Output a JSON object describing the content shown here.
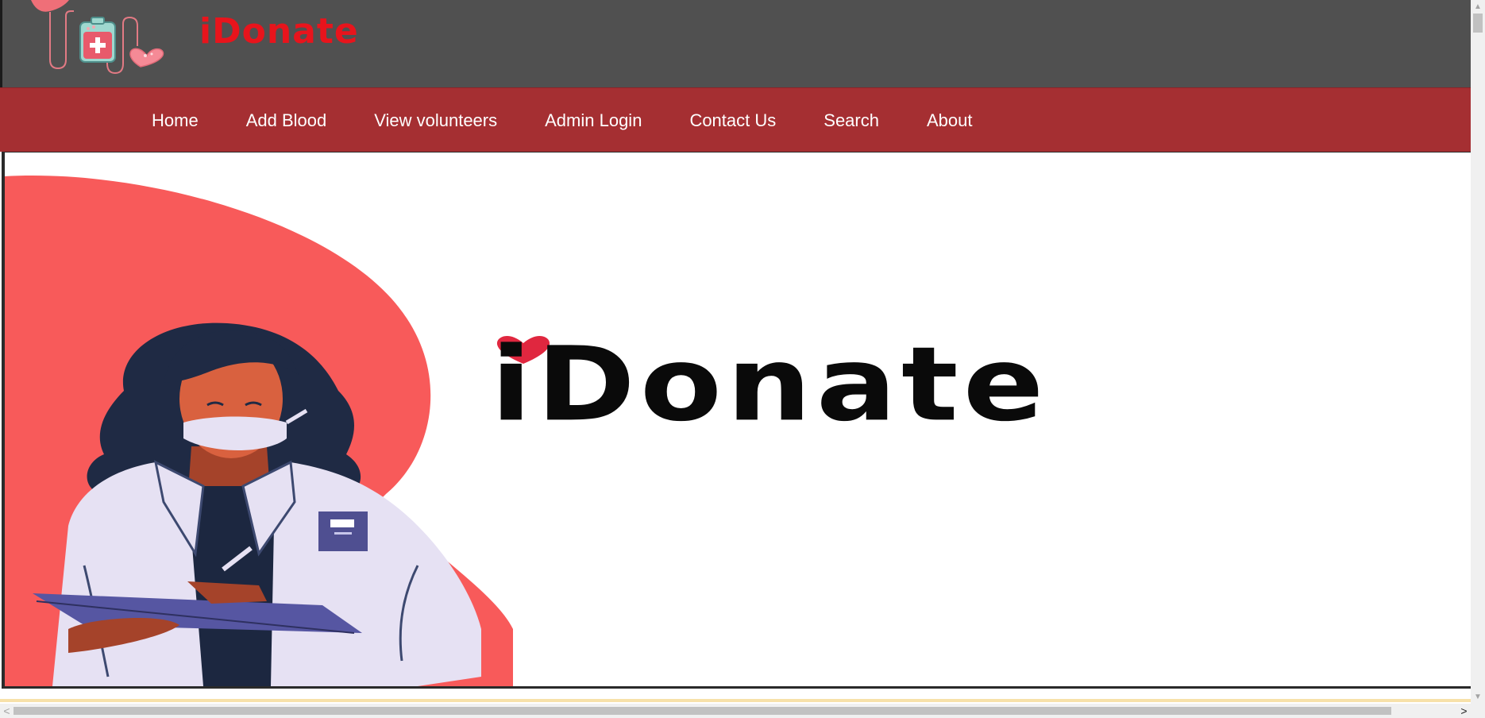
{
  "header": {
    "title": "iDonate",
    "logo": "blood-bag-heart-logo"
  },
  "nav": {
    "items": [
      {
        "label": "Home"
      },
      {
        "label": "Add Blood"
      },
      {
        "label": "View volunteers"
      },
      {
        "label": "Admin Login"
      },
      {
        "label": "Contact Us"
      },
      {
        "label": "Search"
      },
      {
        "label": "About"
      }
    ]
  },
  "hero": {
    "logo_text": "iDonate",
    "illustration": "doctor-with-clipboard-illustration"
  },
  "colors": {
    "topbar": "#505050",
    "navbar": "#a52f32",
    "brand_red": "#e8141c",
    "hero_shape": "#f85a5a"
  },
  "scrollbars": {
    "horizontal_left": "<",
    "horizontal_right": ">"
  }
}
